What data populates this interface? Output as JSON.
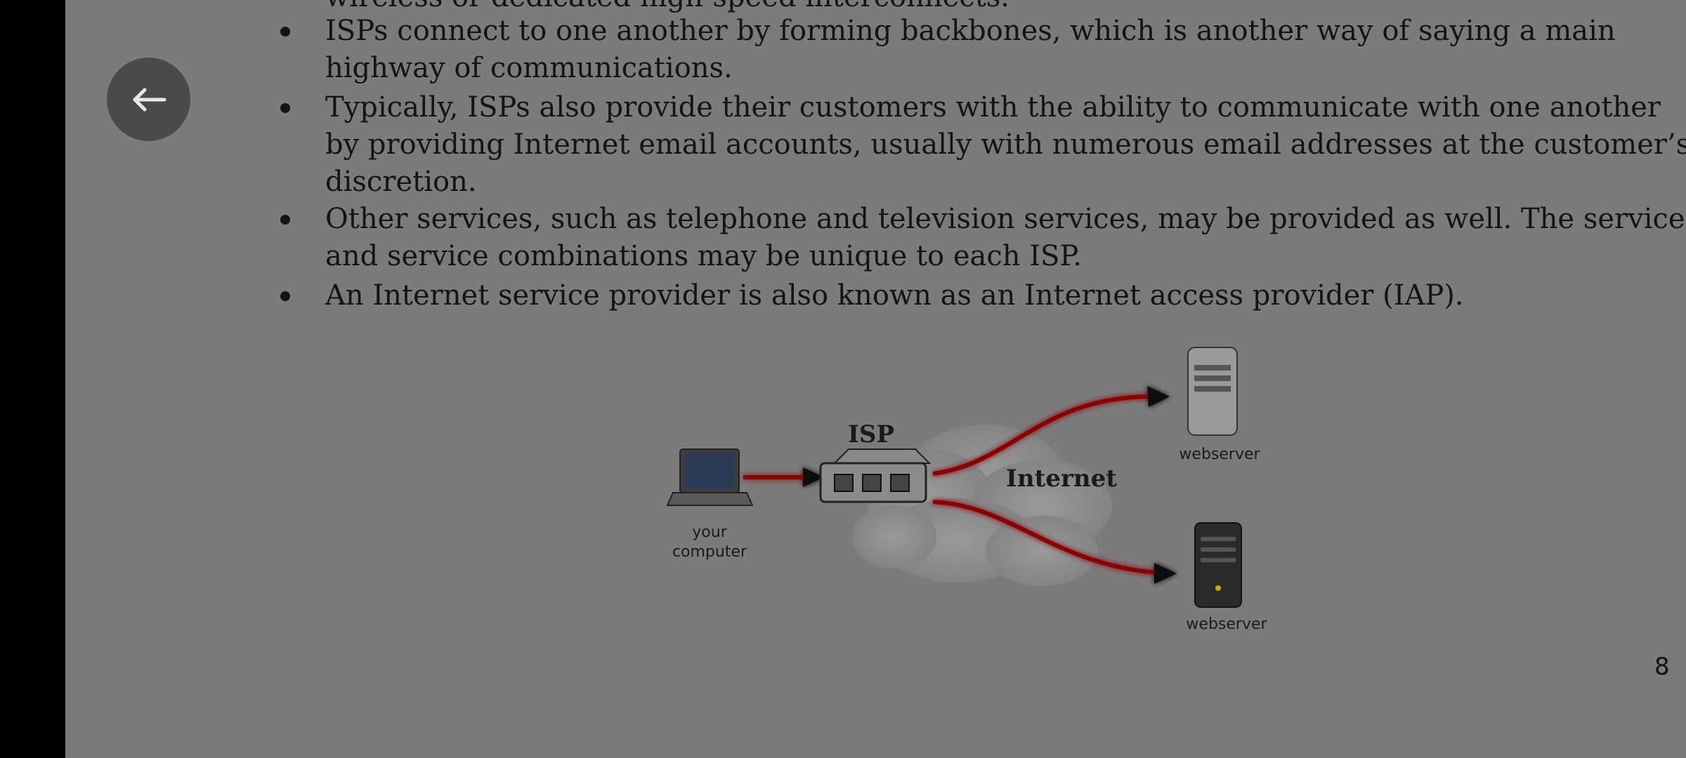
{
  "document": {
    "partial_top_line": "wireless or dedicated high-speed interconnects.",
    "bullets": [
      {
        "lines": [
          "ISPs connect to one another by forming backbones, which is another way of saying a main",
          "highway of communications."
        ]
      },
      {
        "lines": [
          "Typically, ISPs also provide their customers with the ability to communicate with one another",
          "by providing Internet email accounts, usually with numerous email addresses at the customer’s",
          "discretion."
        ]
      },
      {
        "lines": [
          "Other services, such as telephone and television services, may be provided as well. The services",
          "and service combinations may be unique to each ISP."
        ]
      },
      {
        "lines": [
          "An Internet service provider is also known as an Internet access provider (IAP)."
        ]
      }
    ],
    "page_number": "8"
  },
  "figure": {
    "isp_label": "ISP",
    "internet_label": "Internet",
    "computer_label_line1": "your",
    "computer_label_line2": "computer",
    "webserver_top_label": "webserver",
    "webserver_bottom_label": "webserver"
  },
  "controls": {
    "back_icon": "arrow-left-icon"
  },
  "colors": {
    "page_background": "#7b7b7b",
    "overlay_button": "#4a4a4a",
    "arrow_red": "#8b0000"
  }
}
